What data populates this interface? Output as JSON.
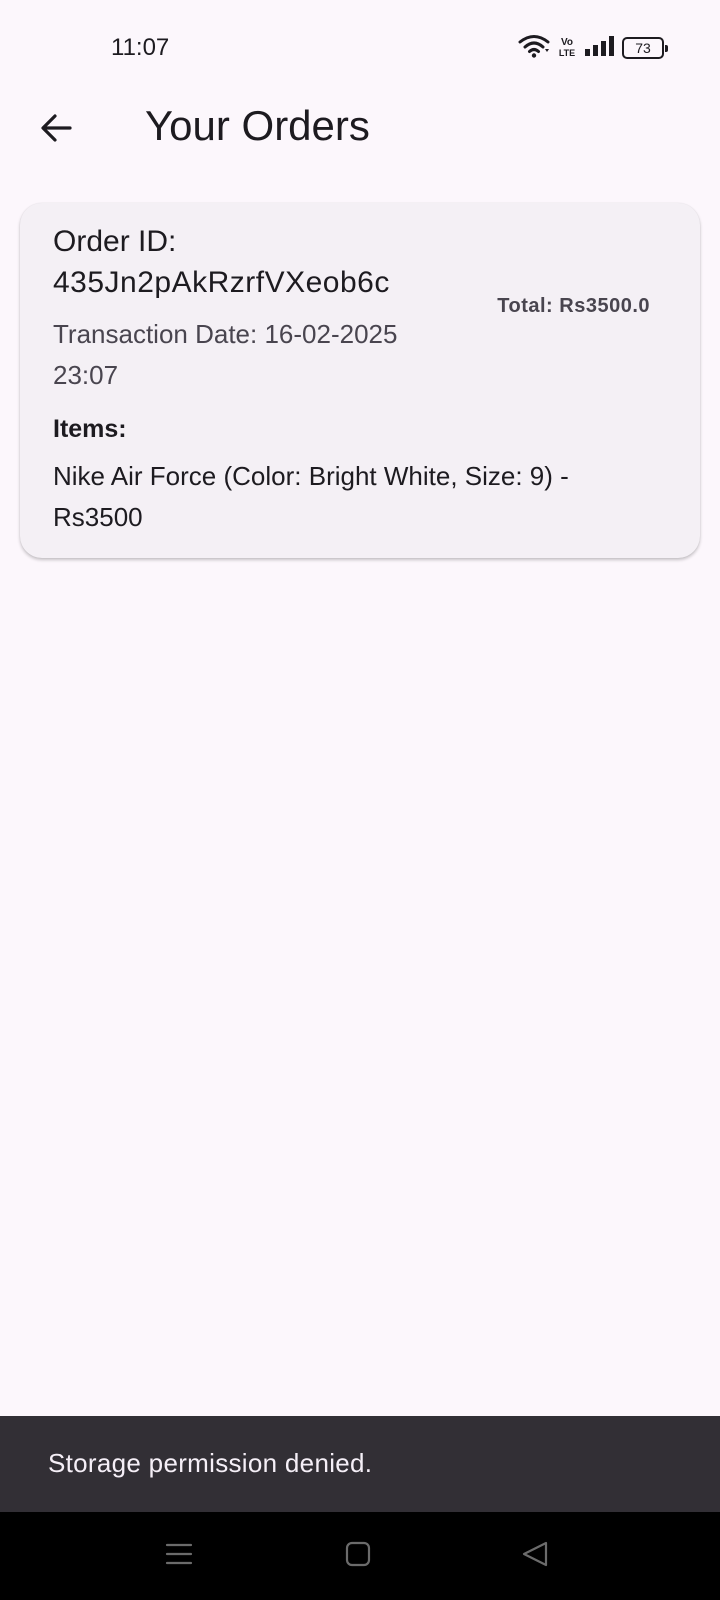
{
  "status_bar": {
    "time": "11:07",
    "volte_top": "Vo",
    "volte_bottom": "LTE",
    "battery": "73"
  },
  "app_bar": {
    "title": "Your Orders"
  },
  "order": {
    "id_label": "Order ID:",
    "id_value": "435Jn2pAkRzrfVXeob6c",
    "date": "Transaction Date: 16-02-2025 23:07",
    "total": "Total: Rs3500.0",
    "items_heading": "Items:",
    "items": [
      "Nike Air Force (Color: Bright White, Size: 9) - Rs3500"
    ]
  },
  "snackbar": {
    "message": "Storage permission denied."
  },
  "colors": {
    "background": "#fcf7fc",
    "card": "#f4f0f5",
    "snackbar": "#322f35",
    "nav_bar": "#000000"
  }
}
